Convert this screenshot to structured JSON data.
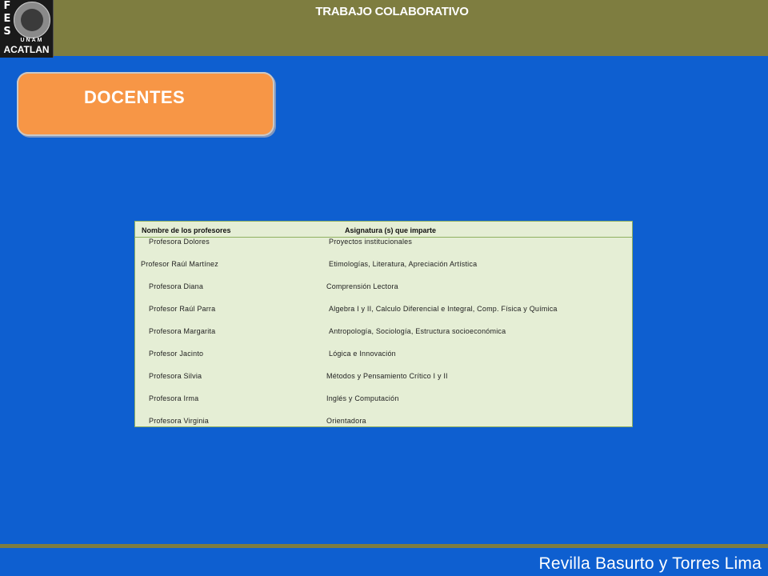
{
  "header": {
    "title": "TRABAJO COLABORATIVO",
    "logo": {
      "letters": [
        "F",
        "E",
        "S"
      ],
      "unam": "UNAM",
      "acatlan": "ACATLAN"
    }
  },
  "section": {
    "title": "DOCENTES"
  },
  "table": {
    "headers": [
      "Nombre de los profesores",
      "Asignatura (s) que imparte"
    ],
    "rows": [
      {
        "name": "Profesora Dolores",
        "subject": "Proyectos institucionales"
      },
      {
        "name": "Profesor Raúl Martínez",
        "subject": "Etimologías, Literatura, Apreciación Artística"
      },
      {
        "name": "Profesora Diana",
        "subject": "Comprensión Lectora"
      },
      {
        "name": "Profesor Raúl Parra",
        "subject": "Algebra I y II, Calculo Diferencial e Integral, Comp. Física y Química"
      },
      {
        "name": "Profesora Margarita",
        "subject": "Antropología, Sociología, Estructura socioeconómica"
      },
      {
        "name": "Profesor Jacinto",
        "subject": "Lógica e Innovación"
      },
      {
        "name": "Profesora Silvia",
        "subject": "Métodos y Pensamiento Crítico I y II"
      },
      {
        "name": "Profesora Irma",
        "subject": "Inglés y Computación"
      },
      {
        "name": "Profesora Virginia",
        "subject": "Orientadora"
      }
    ]
  },
  "footer": {
    "text": "Revilla Basurto y Torres Lima"
  }
}
